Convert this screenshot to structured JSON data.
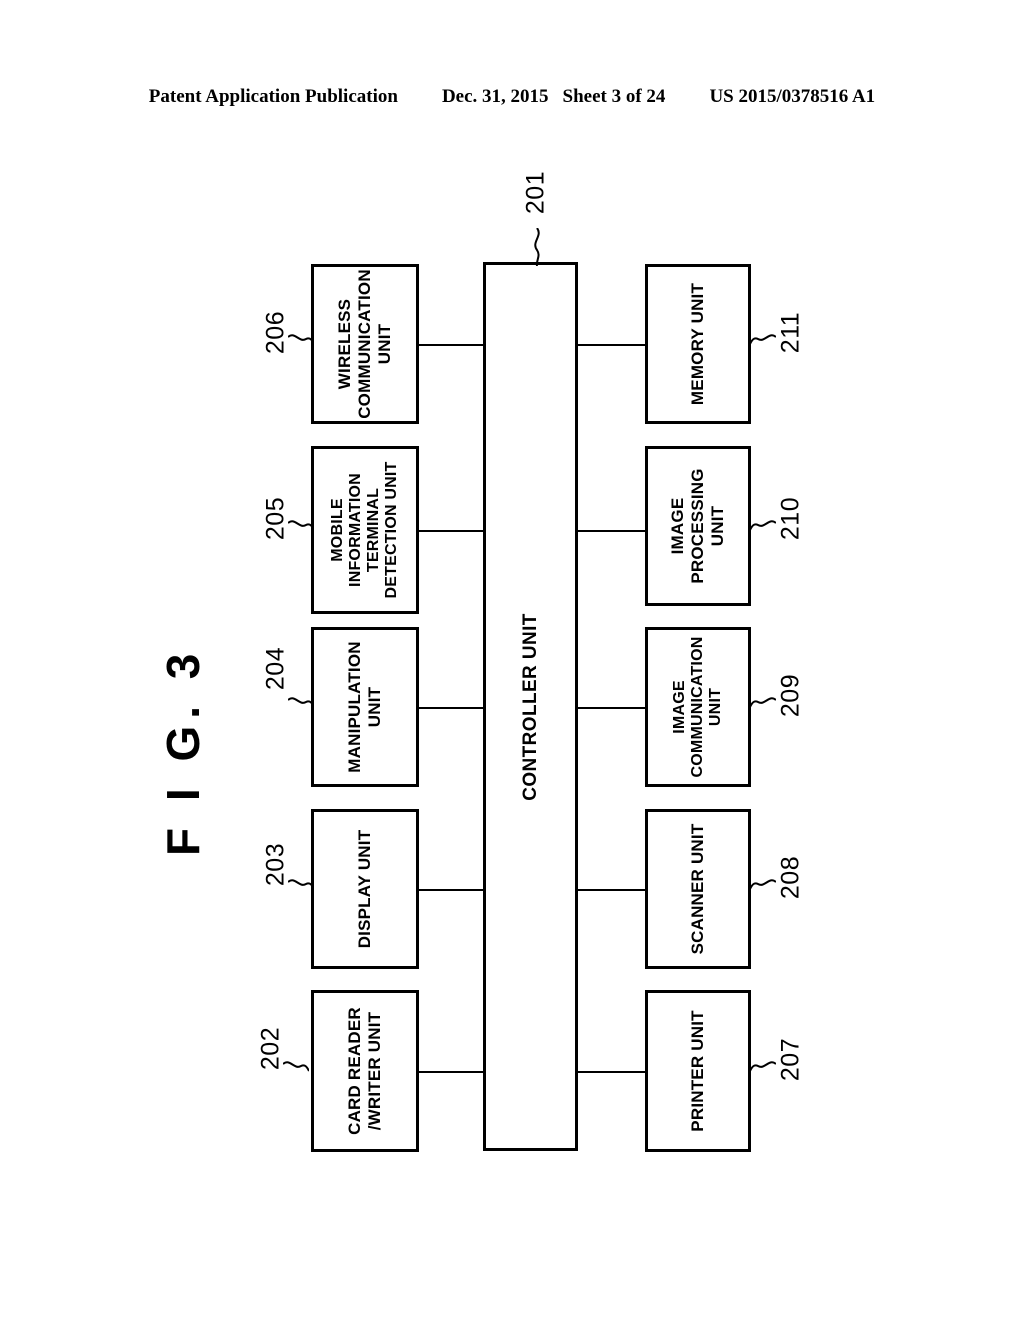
{
  "header": {
    "publication": "Patent Application Publication",
    "date": "Dec. 31, 2015",
    "sheet": "Sheet 3 of 24",
    "patent_number": "US 2015/0378516 A1"
  },
  "figure": {
    "title": "F I G.  3",
    "orientation": "landscape-rotated-90ccw",
    "type": "block-diagram"
  },
  "diagram": {
    "central_unit": {
      "ref": "201",
      "label": "CONTROLLER UNIT"
    },
    "left_column": [
      {
        "ref": "206",
        "label": "WIRELESS\nCOMMUNICATION\nUNIT"
      },
      {
        "ref": "205",
        "label": "MOBILE\nINFORMATION\nTERMINAL\nDETECTION UNIT"
      },
      {
        "ref": "204",
        "label": "MANIPULATION\nUNIT"
      },
      {
        "ref": "203",
        "label": "DISPLAY UNIT"
      },
      {
        "ref": "202",
        "label": "CARD READER\n/WRITER UNIT"
      }
    ],
    "right_column": [
      {
        "ref": "211",
        "label": "MEMORY UNIT"
      },
      {
        "ref": "210",
        "label": "IMAGE\nPROCESSING\nUNIT"
      },
      {
        "ref": "209",
        "label": "IMAGE\nCOMMUNICATION\nUNIT"
      },
      {
        "ref": "208",
        "label": "SCANNER UNIT"
      },
      {
        "ref": "207",
        "label": "PRINTER UNIT"
      }
    ]
  },
  "colors": {
    "ink": "#000000",
    "paper": "#ffffff"
  }
}
